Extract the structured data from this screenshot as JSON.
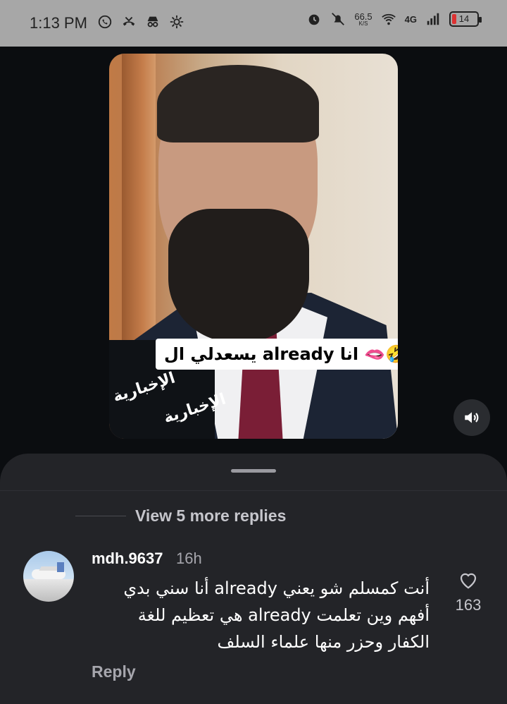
{
  "status_bar": {
    "time": "1:13 PM",
    "net_speed_value": "66.5",
    "net_speed_unit": "K/S",
    "signal_label": "4G",
    "battery_level": "14",
    "icons": [
      "whatsapp-icon",
      "missed-call-icon",
      "incognito-icon",
      "settings-icon",
      "alarm-icon",
      "mute-icon",
      "wifi-icon",
      "signal-icon",
      "battery-icon"
    ]
  },
  "video": {
    "caption": "يسعدلي ال already انا 🫦🤣",
    "mic_text_1": "الإخبارية",
    "mic_text_2": "الإخبارية",
    "volume_icon": "volume-icon"
  },
  "comments": {
    "view_more_label": "View 5 more replies",
    "items": [
      {
        "username": "mdh.9637",
        "time": "16h",
        "text_lines": [
          "أنت كمسلم شو يعني already أنا سني بدي",
          "أفهم وين تعلمت already هي تعظيم للغة",
          "الكفار وحزر منها علماء السلف"
        ],
        "likes": "163",
        "reply_label": "Reply"
      }
    ]
  },
  "colors": {
    "status_bar_bg": "#a7a7a7",
    "app_bg": "#0b0d10",
    "sheet_bg": "#232428",
    "battery_low": "#dd3333"
  }
}
